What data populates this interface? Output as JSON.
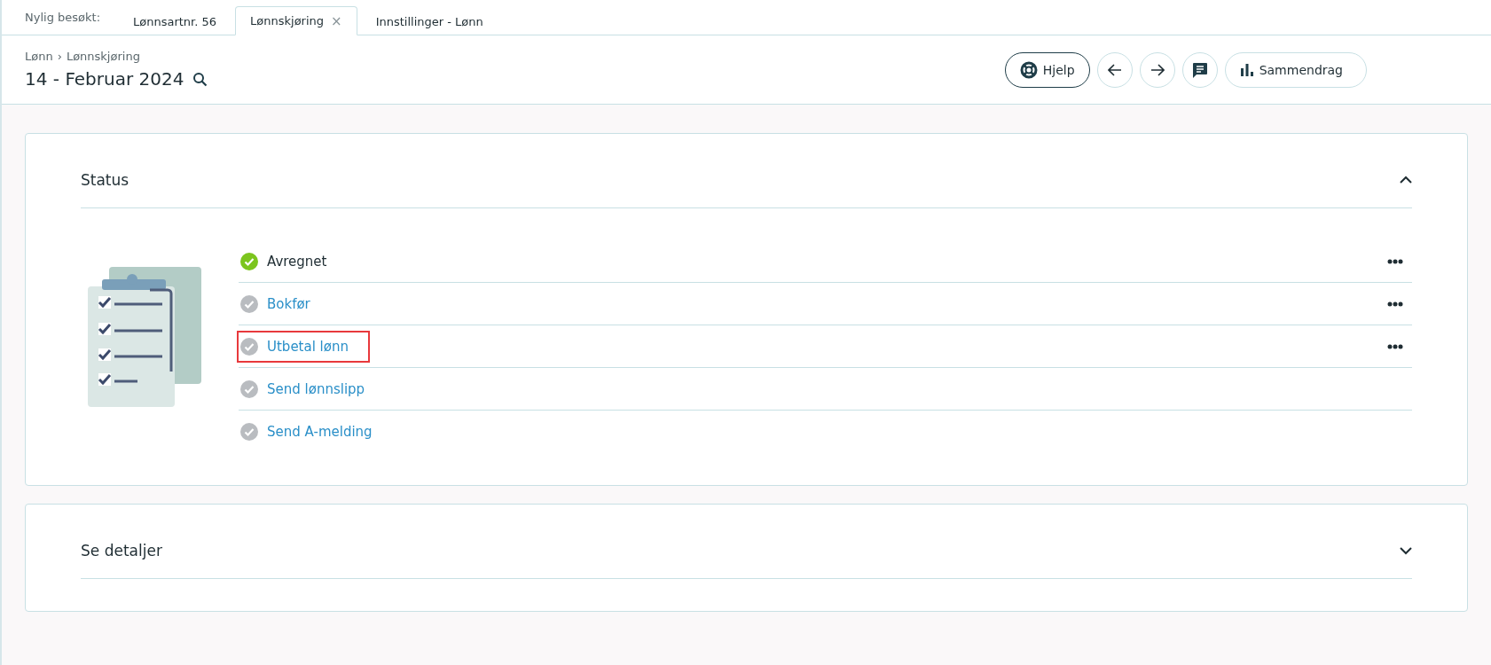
{
  "recent_tabs": {
    "label": "Nylig besøkt:",
    "tabs": [
      {
        "label": "Lønnsartnr. 56",
        "selected": false,
        "closable": false
      },
      {
        "label": "Lønnskjøring",
        "selected": true,
        "closable": true,
        "close": "×"
      },
      {
        "label": "Innstillinger - Lønn",
        "selected": false,
        "closable": false
      }
    ]
  },
  "header": {
    "breadcrumb": [
      "Lønn",
      "Lønnskjøring"
    ],
    "breadcrumb_separator": "›",
    "title": "14 - Februar 2024",
    "buttons": [
      {
        "kind": "help",
        "label": "Hjelp"
      },
      {
        "kind": "back"
      },
      {
        "kind": "forward"
      },
      {
        "kind": "comment"
      },
      {
        "kind": "summary",
        "label": "Sammendrag"
      }
    ]
  },
  "sections": [
    {
      "title": "Status",
      "expanded": true,
      "steps": [
        {
          "label": "Avregnet",
          "done": true,
          "has_menu": true,
          "highlighted": false
        },
        {
          "label": "Bokfør",
          "done": false,
          "has_menu": true,
          "highlighted": false
        },
        {
          "label": "Utbetal lønn",
          "done": false,
          "has_menu": true,
          "highlighted": true
        },
        {
          "label": "Send lønnslipp",
          "done": false,
          "has_menu": false,
          "highlighted": false
        },
        {
          "label": "Send A-melding",
          "done": false,
          "has_menu": false,
          "highlighted": false
        }
      ]
    },
    {
      "title": "Se detaljer",
      "expanded": false
    }
  ]
}
